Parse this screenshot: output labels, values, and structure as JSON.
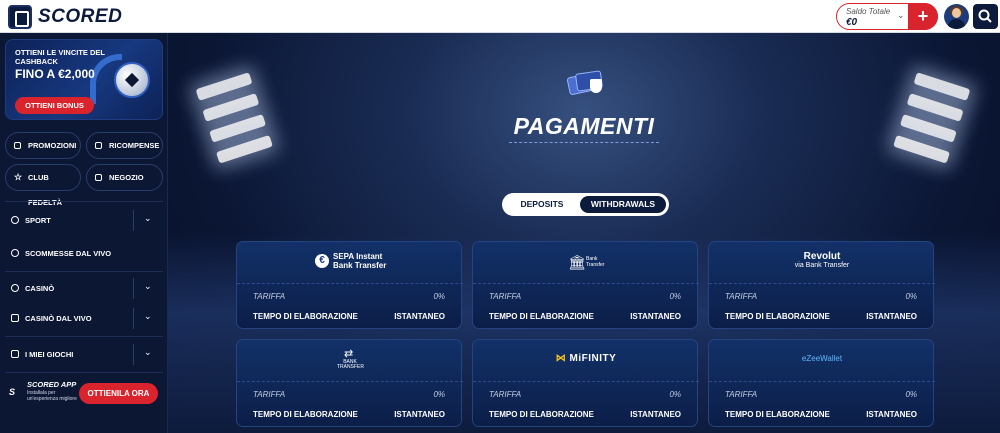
{
  "header": {
    "logo_text": "SCORED",
    "balance_label": "Saldo Totale",
    "balance_value": "€0",
    "deposit_button": "+"
  },
  "sidebar": {
    "promo": {
      "line1": "OTTIENI LE VINCITE DEL CASHBACK",
      "line2": "FINO A €2,000",
      "button": "OTTIENI BONUS"
    },
    "quick_links": [
      {
        "label": "PROMOZIONI",
        "icon": "promotions-icon"
      },
      {
        "label": "RICOMPENSE",
        "icon": "rewards-icon"
      },
      {
        "label": "CLUB FEDELTÀ",
        "icon": "star-icon"
      },
      {
        "label": "NEGOZIO",
        "icon": "shop-icon"
      }
    ],
    "nav": [
      {
        "label": "SPORT",
        "icon": "sport-icon",
        "expandable": true
      },
      {
        "label": "SCOMMESSE DAL VIVO",
        "icon": "live-icon",
        "expandable": false
      },
      {
        "label": "CASINÒ",
        "icon": "casino-icon",
        "expandable": true
      },
      {
        "label": "CASINÒ DAL VIVO",
        "icon": "live-casino-icon",
        "expandable": true
      },
      {
        "label": "I MIEI GIOCHI",
        "icon": "games-icon",
        "expandable": true
      }
    ],
    "app": {
      "title": "SCORED APP",
      "subtitle": "Installala per un'esperienza migliore",
      "button": "OTTIENILA ORA"
    }
  },
  "main": {
    "title": "PAGAMENTI",
    "tabs": [
      {
        "label": "DEPOSITS",
        "active": false
      },
      {
        "label": "WITHDRAWALS",
        "active": true
      }
    ],
    "fee_label": "TARIFFA",
    "time_label": "TEMPO DI ELABORAZIONE",
    "methods": [
      {
        "brand": "SEPA Instant Bank Transfer",
        "brand_line1": "SEPA Instant",
        "brand_line2": "Bank Transfer",
        "fee": "0%",
        "time": "ISTANTANEO"
      },
      {
        "brand": "Bank Transfer",
        "brand_line1": "Bank",
        "brand_line2": "Transfer",
        "fee": "0%",
        "time": "ISTANTANEO"
      },
      {
        "brand": "Revolut via Bank Transfer",
        "brand_line1": "Revolut",
        "brand_line2": "via Bank Transfer",
        "fee": "0%",
        "time": "ISTANTANEO"
      },
      {
        "brand": "BANK TRANSFER",
        "brand_line1": "BANK",
        "brand_line2": "TRANSFER",
        "fee": "0%",
        "time": "ISTANTANEO"
      },
      {
        "brand": "MiFINITY",
        "brand_line1": "MiFINITY",
        "brand_line2": "",
        "fee": "0%",
        "time": "ISTANTANEO"
      },
      {
        "brand": "eZeeWallet",
        "brand_line1": "eZeeWallet",
        "brand_line2": "",
        "fee": "0%",
        "time": "ISTANTANEO"
      }
    ]
  },
  "colors": {
    "accent_red": "#d9232d",
    "navy": "#0c1a3c",
    "sidebar_bg": "#0c1733",
    "card_bg": "#123168"
  }
}
